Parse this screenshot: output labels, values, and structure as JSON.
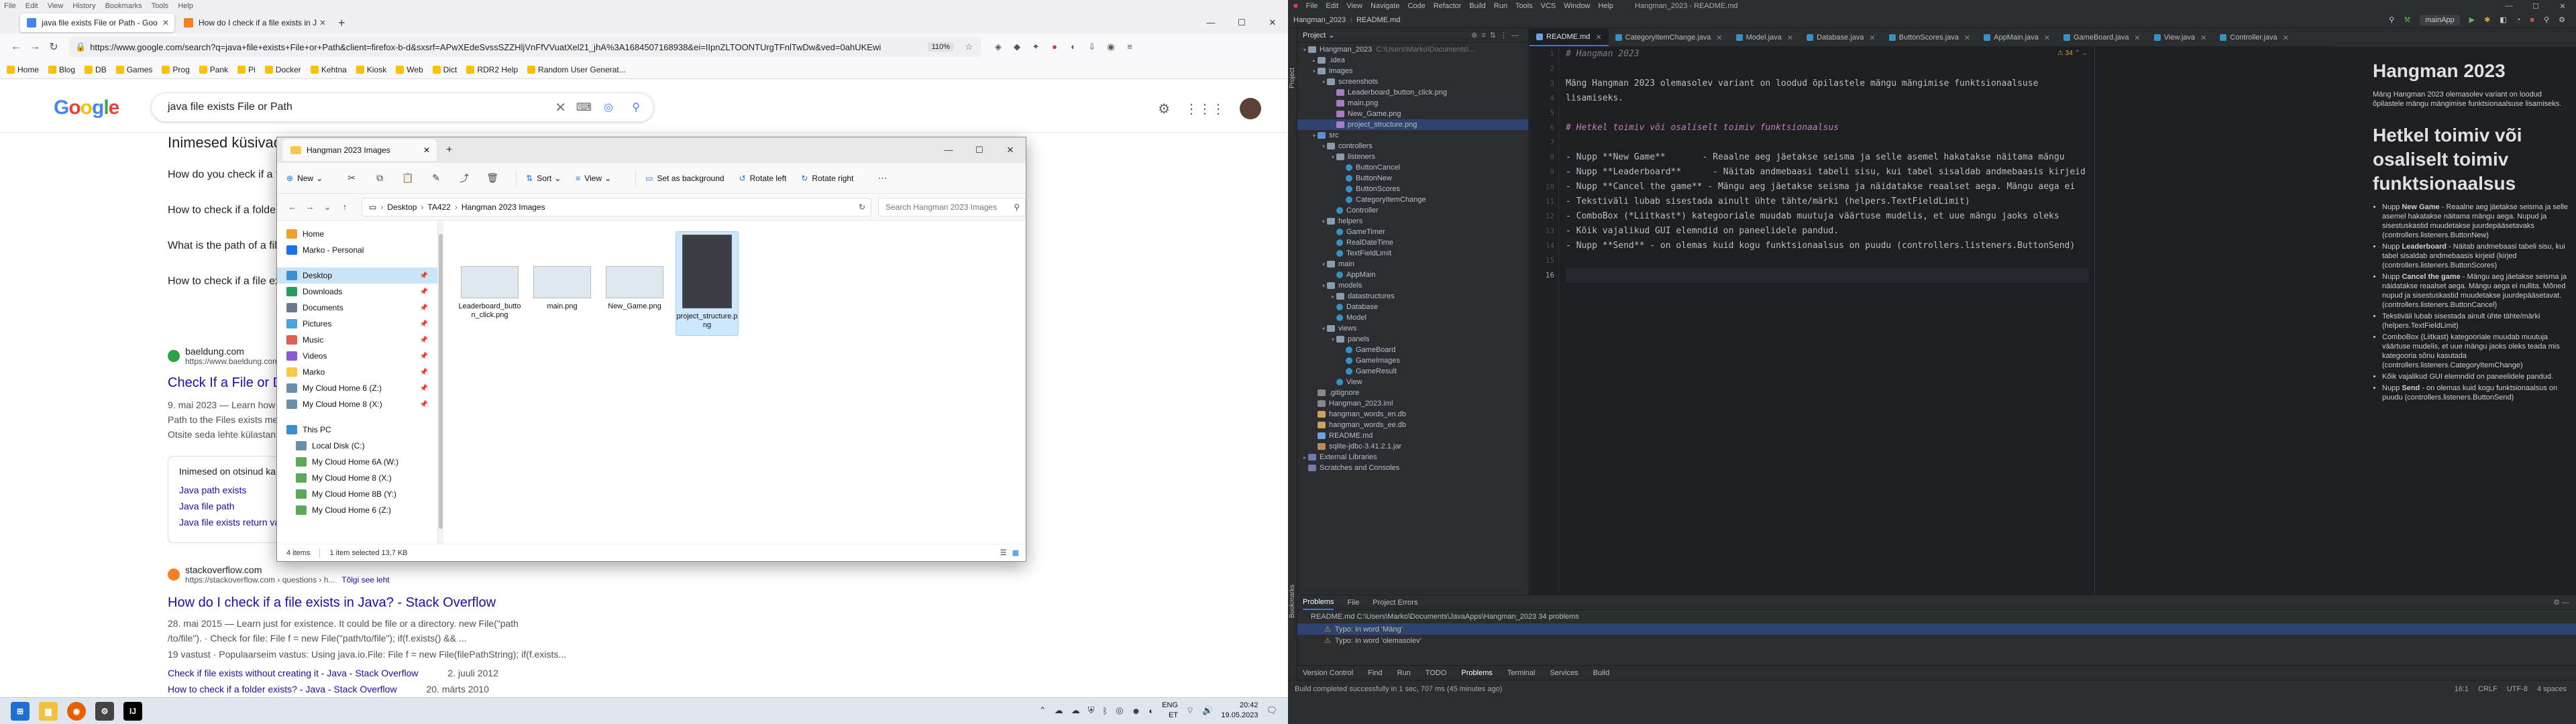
{
  "firefox": {
    "menu": [
      "File",
      "Edit",
      "View",
      "History",
      "Bookmarks",
      "Tools",
      "Help"
    ],
    "tabs": [
      {
        "label": "java file exists File or Path - Goo",
        "active": true,
        "favicon_color": "#4285f4"
      },
      {
        "label": "How do I check if a file exists in J",
        "active": false,
        "favicon_color": "#f48024"
      }
    ],
    "url": "https://www.google.com/search?q=java+file+exists+File+or+Path&client=firefox-b-d&sxsrf=APwXEdeSvssSZZHljVnFfVVuatXel21_jhA%3A1684507168938&ei=IIpnZLTOONTUrgTFnlTwDw&ved=0ahUKEwi",
    "zoom": "110%",
    "bookmarks": [
      "Home",
      "Blog",
      "DB",
      "Games",
      "Prog",
      "Pank",
      "Pi",
      "Docker",
      "Kehtna",
      "Kiosk",
      "Web",
      "Dict",
      "RDR2 Help",
      "Random User Generat..."
    ]
  },
  "google": {
    "logo": "Google",
    "query": "java file exists File or Path",
    "paa_title": "Inimesed küsivad ka",
    "paa": [
      "How do you check if a file exists in Java?",
      "How to check if a folder exists in Java?",
      "What is the path of a file in Java?",
      "How to check if a file exists in directory?"
    ],
    "r1": {
      "site": "baeldung.com",
      "url": "https://www.baeldung.com › java-file-directory-exists",
      "title": "Check If a File or Directory Exists in Java | Baeldung",
      "snip1": "9. mai 2023 — Learn how to check if a file or directory exists using the Files and",
      "snip2": "Path to the Files exists method... and the legacy File API.",
      "snip3": "Otsite seda lehte külastanud mitu korda."
    },
    "incl_title": "Inimesed on otsinud ka",
    "incl_links": [
      "Java path exists",
      "Java file path",
      "Java file exists return value"
    ],
    "r2": {
      "site": "stackoverflow.com",
      "url": "https://stackoverflow.com › questions › h...",
      "translate": "Tõlgi see leht",
      "title": "How do I check if a file exists in Java? - Stack Overflow",
      "snip1": "28. mai 2015 — Learn just for existence. It could be file or a directory. new File(\"path",
      "snip2": "/to/file\"). · Check for file: File f = new File(\"path/to/file\"); if(f.exists() && ...",
      "snip3": "19 vastust · Populaarseim vastus: Using java.io.File: File f = new File(filePathString); if(f.exists...",
      "sub_link": "Check if file exists without creating it - Java - Stack Overflow",
      "sub_date": "2. juuli 2012",
      "sub_link2": "How to check if a folder exists? - Java - Stack Overflow",
      "sub_date2": "20. märts 2010"
    }
  },
  "explorer": {
    "tab_title": "Hangman 2023 Images",
    "toolbar": {
      "new": "New",
      "sort": "Sort",
      "view": "View",
      "set_bg": "Set as background",
      "rotate_left": "Rotate left",
      "rotate_right": "Rotate right"
    },
    "path": [
      "Desktop",
      "TA422",
      "Hangman 2023 Images"
    ],
    "search_placeholder": "Search Hangman 2023 Images",
    "nav": [
      {
        "label": "Home",
        "color": "#f0a030",
        "pin": false,
        "sel": false
      },
      {
        "label": "Marko - Personal",
        "color": "#1a73e8",
        "pin": false,
        "sel": false
      },
      {
        "label": "Desktop",
        "color": "#3b8ed6",
        "pin": true,
        "sel": true
      },
      {
        "label": "Downloads",
        "color": "#2a9b5a",
        "pin": true,
        "sel": false
      },
      {
        "label": "Documents",
        "color": "#6b7b8c",
        "pin": true,
        "sel": false
      },
      {
        "label": "Pictures",
        "color": "#4aa3df",
        "pin": true,
        "sel": false
      },
      {
        "label": "Music",
        "color": "#e06050",
        "pin": true,
        "sel": false
      },
      {
        "label": "Videos",
        "color": "#8a5ad0",
        "pin": true,
        "sel": false
      },
      {
        "label": "Marko",
        "color": "#f7c948",
        "pin": true,
        "sel": false
      },
      {
        "label": "My Cloud Home 6 (Z:)",
        "color": "#6c8ea8",
        "pin": true,
        "sel": false
      },
      {
        "label": "My Cloud Home 8 (X:)",
        "color": "#6c8ea8",
        "pin": true,
        "sel": false
      }
    ],
    "nav2": [
      {
        "label": "This PC",
        "color": "#3b8ed6"
      },
      {
        "label": "Local Disk (C:)",
        "color": "#6c8ea8"
      },
      {
        "label": "My Cloud Home 6A (W:)",
        "color": "#5aa85a"
      },
      {
        "label": "My Cloud Home 8 (X:)",
        "color": "#5aa85a"
      },
      {
        "label": "My Cloud Home 8B (Y:)",
        "color": "#5aa85a"
      },
      {
        "label": "My Cloud Home 6 (Z:)",
        "color": "#5aa85a"
      }
    ],
    "files": [
      {
        "name": "Leaderboard_button_click.png",
        "tall": false,
        "sel": false
      },
      {
        "name": "main.png",
        "tall": false,
        "sel": false
      },
      {
        "name": "New_Game.png",
        "tall": false,
        "sel": false
      },
      {
        "name": "project_structure.png",
        "tall": true,
        "sel": true
      }
    ],
    "status_items": "4 items",
    "status_sel": "1 item selected  13,7 KB"
  },
  "taskbar_left": {
    "lang": "ENG",
    "region": "ET",
    "time": "20:42",
    "date": "19.05.2023"
  },
  "intellij": {
    "menu": [
      "File",
      "Edit",
      "View",
      "Navigate",
      "Code",
      "Refactor",
      "Build",
      "Run",
      "Tools",
      "VCS",
      "Window",
      "Help"
    ],
    "window_title": "Hangman_2023 - README.md",
    "breadcrumb": [
      "Hangman_2023",
      "README.md"
    ],
    "run_config": "mainApp",
    "project_title": "Project",
    "tree": [
      {
        "d": 0,
        "ar": "▾",
        "ic": "folder",
        "label": "Hangman_2023",
        "hint": "C:\\Users\\Marko\\Documents\\...",
        "sel": false
      },
      {
        "d": 1,
        "ar": "▸",
        "ic": "folder",
        "label": ".idea",
        "hint": "",
        "sel": false
      },
      {
        "d": 1,
        "ar": "▾",
        "ic": "folder",
        "label": "images",
        "hint": "",
        "sel": false
      },
      {
        "d": 2,
        "ar": "▾",
        "ic": "folder",
        "label": "screenshots",
        "hint": "",
        "sel": false
      },
      {
        "d": 3,
        "ar": "",
        "ic": "img",
        "label": "Leaderboard_button_click.png",
        "hint": "",
        "sel": false
      },
      {
        "d": 3,
        "ar": "",
        "ic": "img",
        "label": "main.png",
        "hint": "",
        "sel": false
      },
      {
        "d": 3,
        "ar": "",
        "ic": "img",
        "label": "New_Game.png",
        "hint": "",
        "sel": false
      },
      {
        "d": 3,
        "ar": "",
        "ic": "img",
        "label": "project_structure.png",
        "hint": "",
        "sel": true
      },
      {
        "d": 1,
        "ar": "▾",
        "ic": "src",
        "label": "src",
        "hint": "",
        "sel": false
      },
      {
        "d": 2,
        "ar": "▾",
        "ic": "folder",
        "label": "controllers",
        "hint": "",
        "sel": false
      },
      {
        "d": 3,
        "ar": "▾",
        "ic": "folder",
        "label": "listeners",
        "hint": "",
        "sel": false
      },
      {
        "d": 4,
        "ar": "",
        "ic": "class",
        "label": "ButtonCancel",
        "hint": "",
        "sel": false
      },
      {
        "d": 4,
        "ar": "",
        "ic": "class",
        "label": "ButtonNew",
        "hint": "",
        "sel": false
      },
      {
        "d": 4,
        "ar": "",
        "ic": "class",
        "label": "ButtonScores",
        "hint": "",
        "sel": false
      },
      {
        "d": 4,
        "ar": "",
        "ic": "class",
        "label": "CategoryItemChange",
        "hint": "",
        "sel": false
      },
      {
        "d": 3,
        "ar": "",
        "ic": "class",
        "label": "Controller",
        "hint": "",
        "sel": false
      },
      {
        "d": 2,
        "ar": "▾",
        "ic": "folder",
        "label": "helpers",
        "hint": "",
        "sel": false
      },
      {
        "d": 3,
        "ar": "",
        "ic": "class",
        "label": "GameTimer",
        "hint": "",
        "sel": false
      },
      {
        "d": 3,
        "ar": "",
        "ic": "class",
        "label": "RealDateTime",
        "hint": "",
        "sel": false
      },
      {
        "d": 3,
        "ar": "",
        "ic": "class",
        "label": "TextFieldLimit",
        "hint": "",
        "sel": false
      },
      {
        "d": 2,
        "ar": "▾",
        "ic": "folder",
        "label": "main",
        "hint": "",
        "sel": false
      },
      {
        "d": 3,
        "ar": "",
        "ic": "class",
        "label": "AppMain",
        "hint": "",
        "sel": false
      },
      {
        "d": 2,
        "ar": "▾",
        "ic": "folder",
        "label": "models",
        "hint": "",
        "sel": false
      },
      {
        "d": 3,
        "ar": "▸",
        "ic": "folder",
        "label": "datastructures",
        "hint": "",
        "sel": false
      },
      {
        "d": 3,
        "ar": "",
        "ic": "class",
        "label": "Database",
        "hint": "",
        "sel": false
      },
      {
        "d": 3,
        "ar": "",
        "ic": "class",
        "label": "Model",
        "hint": "",
        "sel": false
      },
      {
        "d": 2,
        "ar": "▾",
        "ic": "folder",
        "label": "views",
        "hint": "",
        "sel": false
      },
      {
        "d": 3,
        "ar": "▾",
        "ic": "folder",
        "label": "panels",
        "hint": "",
        "sel": false
      },
      {
        "d": 4,
        "ar": "",
        "ic": "class",
        "label": "GameBoard",
        "hint": "",
        "sel": false
      },
      {
        "d": 4,
        "ar": "",
        "ic": "class",
        "label": "GameImages",
        "hint": "",
        "sel": false
      },
      {
        "d": 4,
        "ar": "",
        "ic": "class",
        "label": "GameResult",
        "hint": "",
        "sel": false
      },
      {
        "d": 3,
        "ar": "",
        "ic": "class",
        "label": "View",
        "hint": "",
        "sel": false
      },
      {
        "d": 1,
        "ar": "",
        "ic": "file",
        "label": ".gitignore",
        "hint": "",
        "sel": false
      },
      {
        "d": 1,
        "ar": "",
        "ic": "file",
        "label": "Hangman_2023.iml",
        "hint": "",
        "sel": false
      },
      {
        "d": 1,
        "ar": "",
        "ic": "db",
        "label": "hangman_words_en.db",
        "hint": "",
        "sel": false
      },
      {
        "d": 1,
        "ar": "",
        "ic": "db",
        "label": "hangman_words_ee.db",
        "hint": "",
        "sel": false
      },
      {
        "d": 1,
        "ar": "",
        "ic": "md",
        "label": "README.md",
        "hint": "",
        "sel": false
      },
      {
        "d": 1,
        "ar": "",
        "ic": "jar",
        "label": "sqlite-jdbc-3.41.2.1.jar",
        "hint": "",
        "sel": false
      },
      {
        "d": 0,
        "ar": "▸",
        "ic": "lib",
        "label": "External Libraries",
        "hint": "",
        "sel": false
      },
      {
        "d": 0,
        "ar": "",
        "ic": "lib",
        "label": "Scratches and Consoles",
        "hint": "",
        "sel": false
      }
    ],
    "editor_tabs": [
      {
        "label": "README.md",
        "active": true,
        "color": "#6aa2e0"
      },
      {
        "label": "CategoryItemChange.java",
        "active": false,
        "color": "#3592c4"
      },
      {
        "label": "Model.java",
        "active": false,
        "color": "#3592c4"
      },
      {
        "label": "Database.java",
        "active": false,
        "color": "#3592c4"
      },
      {
        "label": "ButtonScores.java",
        "active": false,
        "color": "#3592c4"
      },
      {
        "label": "AppMain.java",
        "active": false,
        "color": "#3592c4"
      },
      {
        "label": "GameBoard.java",
        "active": false,
        "color": "#3592c4"
      },
      {
        "label": "View.java",
        "active": false,
        "color": "#3592c4"
      },
      {
        "label": "Controller.java",
        "active": false,
        "color": "#3592c4"
      }
    ],
    "inspections": "⚠ 34",
    "code_lines": [
      {
        "cls": "c-head",
        "text": "# Hangman 2023"
      },
      {
        "cls": "",
        "text": ""
      },
      {
        "cls": "",
        "text": "Mäng Hangman 2023 olemasolev variant on loodud õpilastele mängu mängimise funktsionaalsuse"
      },
      {
        "cls": "",
        "text": "lisamiseks."
      },
      {
        "cls": "",
        "text": ""
      },
      {
        "cls": "c-head2",
        "text": "# Hetkel toimiv või osaliselt toimiv funktsionaalsus"
      },
      {
        "cls": "",
        "text": ""
      },
      {
        "cls": "",
        "text": "- Nupp **New Game**       - Reaalne aeg jäetakse seisma ja selle asemel hakatakse näitama mängu"
      },
      {
        "cls": "",
        "text": "- Nupp **Leaderboard**      - Näitab andmebaasi tabeli sisu, kui tabel sisaldab andmebaasis kirjeid"
      },
      {
        "cls": "",
        "text": "- Nupp **Cancel the game** - Mängu aeg jäetakse seisma ja näidatakse reaalset aega. Mängu aega ei"
      },
      {
        "cls": "",
        "text": "- Tekstiväli lubab sisestada ainult ühte tähte/märki (helpers.TextFieldLimit)"
      },
      {
        "cls": "",
        "text": "- ComboBox (*Liitkast*) kategooriale muudab muutuja väärtuse mudelis, et uue mängu jaoks oleks"
      },
      {
        "cls": "",
        "text": "- Kõik vajalikud GUI elemndid on paneelidele pandud."
      },
      {
        "cls": "",
        "text": "- Nupp **Send** - on olemas kuid kogu funktsionaalsus on puudu (controllers.listeners.ButtonSend)"
      },
      {
        "cls": "",
        "text": ""
      },
      {
        "cls": "",
        "text": ""
      }
    ],
    "preview": {
      "h1": "Hangman 2023",
      "p1": "Mäng Hangman 2023 olemasolev variant on loodud õpilastele mängu mängimise funktsionaalsuse lisamiseks.",
      "h2": "Hetkel toimiv või osaliselt toimiv funktsionaalsus",
      "items": [
        {
          "pre": "Nupp ",
          "b": "New Game",
          "post": " - Reaalne aeg jäetakse seisma ja selle asemel hakatakse näitama mängu aega. Nupud ja sisestuskastid muudetakse juurdepääsetavaks (controllers.listeners.ButtonNew)"
        },
        {
          "pre": "Nupp ",
          "b": "Leaderboard",
          "post": " - Näitab andmebaasi tabeli sisu, kui tabel sisaldab andmebaasis kirjeid (kirjed (controllers.listeners.ButtonScores)"
        },
        {
          "pre": "Nupp ",
          "b": "Cancel the game",
          "post": " - Mängu aeg jäetakse seisma ja näidatakse reaalset aega. Mängu aega ei nullita. Mõned nupud ja sisestuskastid muudetakse juurdepääsetavat. (controllers.listeners.ButtonCancel)"
        },
        {
          "pre": "",
          "b": "",
          "post": "Tekstiväli lubab sisestada ainult ühte tähte/märki (helpers.TextFieldLimit)"
        },
        {
          "pre": "",
          "b": "",
          "post": "ComboBox (Liitkast) kategooriale muudab muutuja väärtuse mudelis, et uue mängu jaoks oleks teada mis kategooria sõnu kasutada (controllers.listeners.CategoryItemChange)"
        },
        {
          "pre": "",
          "b": "",
          "post": "Kõik vajalikud GUI elemndid on paneelidele pandud."
        },
        {
          "pre": "Nupp ",
          "b": "Send",
          "post": " - on olemas kuid kogu funktsionaalsus on puudu (controllers.listeners.ButtonSend)"
        }
      ]
    },
    "bottom_tabs": [
      "Problems",
      "File",
      "Project Errors"
    ],
    "bottom_file": "README.md  C:\\Users\\Marko\\Documents\\JavaApps\\Hangman_2023  34 problems",
    "issues": [
      "Typo: In word 'Mäng'",
      "Typo: In word 'olemasolev'"
    ],
    "tool_strip": [
      "Version Control",
      "Find",
      "Run",
      "TODO",
      "Problems",
      "Terminal",
      "Services",
      "Build"
    ],
    "status_text": "Build completed successfully in 1 sec, 707 ms (45 minutes ago)",
    "status_right": [
      "16:1",
      "CRLF",
      "UTF-8",
      "4 spaces"
    ]
  },
  "taskbar_right": {
    "time": "20:42",
    "date": "19.05.2023"
  }
}
